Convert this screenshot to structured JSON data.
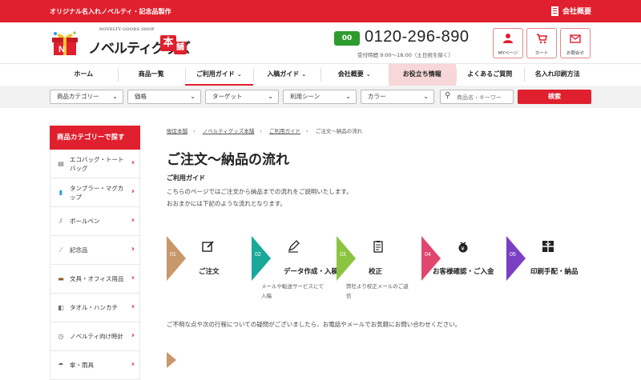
{
  "topbar": {
    "tagline": "オリジナル名入れノベルティ・記念品製作",
    "company_link": "会社概要"
  },
  "logo": {
    "subtitle": "NOVELTY GOODS SHOP",
    "name": "ノベルティグッズ",
    "suffix1": "本",
    "suffix2": "舗"
  },
  "contact": {
    "freedial": "00",
    "phone": "0120-296-890",
    "hours": "受付時間 9:00～18:00（土日祝を除く）"
  },
  "header_buttons": [
    {
      "label": "MYページ",
      "icon": "user-icon"
    },
    {
      "label": "カート",
      "icon": "cart-icon"
    },
    {
      "label": "お問合せ",
      "icon": "mail-icon"
    }
  ],
  "nav": [
    {
      "label": "ホーム"
    },
    {
      "label": "商品一覧"
    },
    {
      "label": "ご利用ガイド"
    },
    {
      "label": "入稿ガイド"
    },
    {
      "label": "会社概要"
    },
    {
      "label": "お役立ち情報"
    },
    {
      "label": "よくあるご質問"
    },
    {
      "label": "名入れ印刷方法"
    }
  ],
  "filters": [
    "商品カテゴリー",
    "価格",
    "ターゲット",
    "利用シーン",
    "カラー"
  ],
  "search": {
    "placeholder": "商品名・キーワー",
    "button": "検索"
  },
  "sidebar": {
    "title": "商品カテゴリーで探す",
    "items": [
      {
        "label": "エコバッグ・トートバッグ",
        "icon": "bag-icon"
      },
      {
        "label": "タンブラー・マグカップ",
        "icon": "tumbler-icon"
      },
      {
        "label": "ボールペン",
        "icon": "pen-icon"
      },
      {
        "label": "記念品",
        "icon": "gift-icon"
      },
      {
        "label": "文具・オフィス用品",
        "icon": "stationery-icon"
      },
      {
        "label": "タオル・ハンカチ",
        "icon": "towel-icon"
      },
      {
        "label": "ノベルティ向け時計",
        "icon": "clock-icon"
      },
      {
        "label": "傘・雨具",
        "icon": "umbrella-icon"
      }
    ]
  },
  "breadcrumb": [
    "販促本舗",
    "ノベルティグッズ本舗",
    "ご利用ガイド",
    "ご注文～納品の流れ"
  ],
  "page": {
    "title": "ご注文～納品の流れ",
    "subheading": "ご利用ガイド",
    "intro1": "こちらのページではご注文から納品までの流れをご説明いたします。",
    "intro2": "おおまかには下記のような流れとなります。",
    "closing": "ご不明な点や次の行程についての疑問がございましたら、お電話やメールでお気軽にお問い合わせください。"
  },
  "steps": [
    {
      "no": "01",
      "title": "ご注文",
      "desc": "",
      "color": "#c8976a",
      "icon": "edit-icon"
    },
    {
      "no": "02",
      "title": "データ作成・入稿",
      "desc": "メールや転送サービスにて入稿",
      "color": "#1aa89a",
      "icon": "pen-icon"
    },
    {
      "no": "03",
      "title": "校正",
      "desc": "弊社より校正メールのご返信",
      "color": "#8cc43f",
      "icon": "clipboard-icon"
    },
    {
      "no": "04",
      "title": "お客様確認・ご入金",
      "desc": "",
      "color": "#e0466e",
      "icon": "moneybag-icon"
    },
    {
      "no": "05",
      "title": "印刷手配・納品",
      "desc": "",
      "color": "#7b3fc4",
      "icon": "package-icon"
    }
  ],
  "colors": {
    "brand_red": "#e0202e",
    "highlight": "#f8d7d9"
  }
}
